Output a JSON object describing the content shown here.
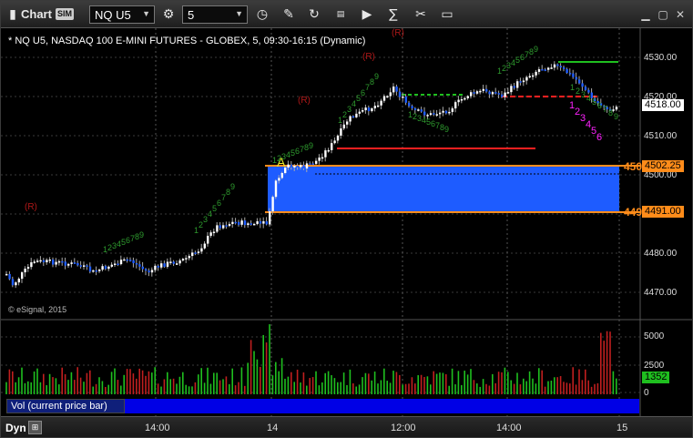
{
  "toolbar": {
    "title": "Chart",
    "badge": "SIM",
    "symbol": "NQ U5",
    "interval": "5",
    "icons": [
      "chart-icon",
      "settings-icon",
      "refresh-icon",
      "draw-pencil-icon",
      "link-icon",
      "tick-icon",
      "play-icon",
      "formula-icon",
      "tools-icon",
      "message-icon",
      "minimize-icon",
      "maximize-icon",
      "close-icon"
    ]
  },
  "chart": {
    "title": "* NQ U5, NASDAQ 100 E-MINI FUTURES - GLOBEX, 5, 09:30-16:15 (Dynamic)",
    "copyright": "© eSignal, 2015",
    "price_ticks": [
      "4530.00",
      "4520.00",
      "4510.00",
      "4500.00",
      "4490.00",
      "4480.00",
      "4470.00"
    ],
    "last_price": "4518.00",
    "zone_top": "4502.25",
    "zone_bottom": "4491.00",
    "zone_top_left": "450",
    "zone_bottom_left": "449",
    "marker_r": "(R)",
    "marker_a": "A",
    "colors": {
      "up": "#ffffff",
      "down": "#1e5cff",
      "zone": "#1e5cff",
      "orange": "#ff8c1a",
      "red": "#ff2020",
      "green": "#1fbf1f",
      "magenta": "#ff22ff",
      "seq_green": "#2e9a2e"
    }
  },
  "volume": {
    "ticks": [
      "5000",
      "2500",
      "0"
    ],
    "last_volume": "1352",
    "study_label": "Vol (current price bar)"
  },
  "bottom": {
    "mode": "Dyn",
    "time_labels": [
      "14:00",
      "14",
      "12:00",
      "14:00",
      "15"
    ]
  }
}
